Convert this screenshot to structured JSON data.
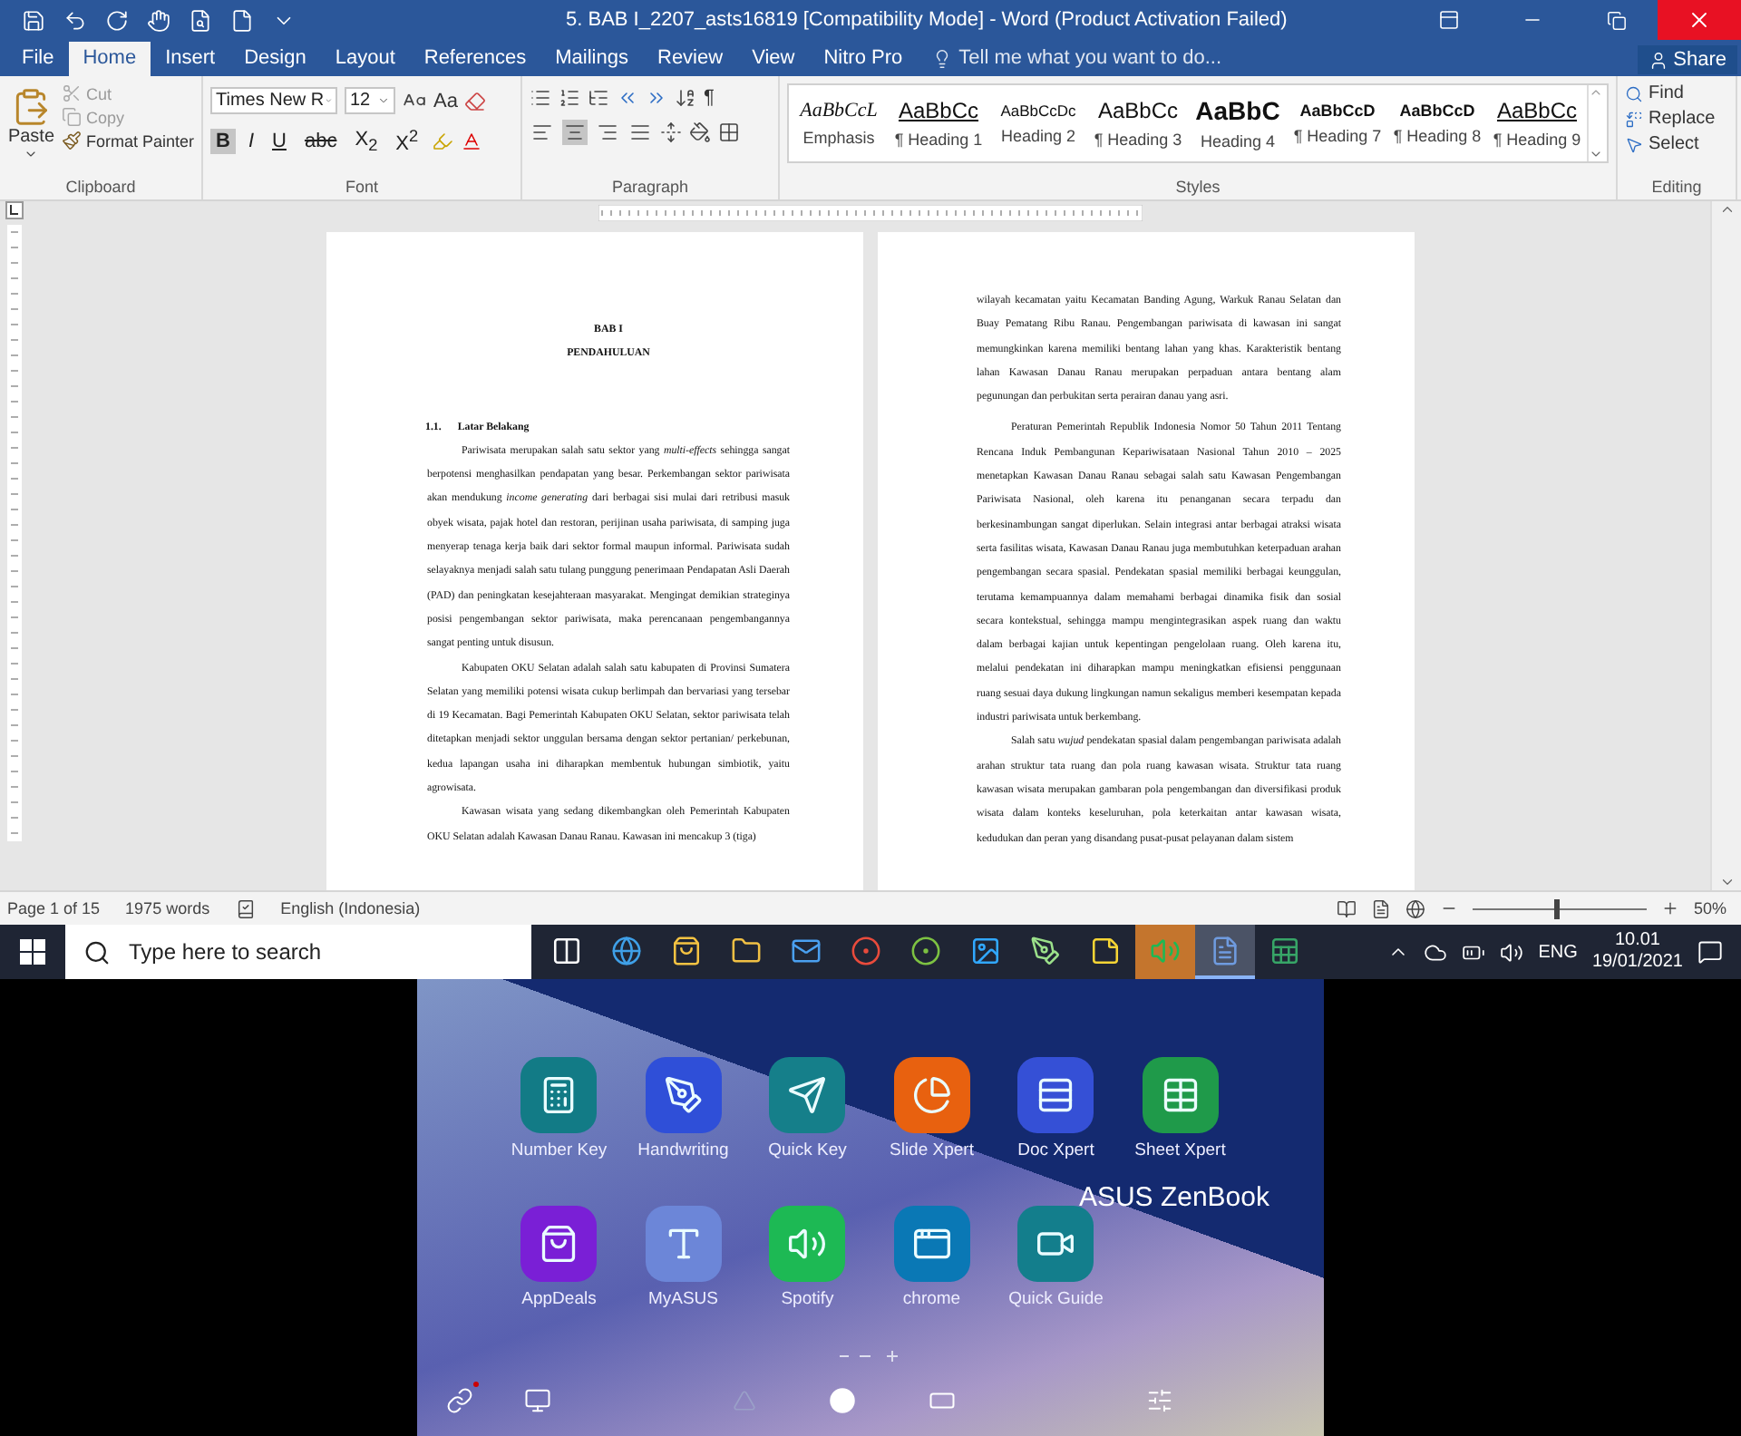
{
  "window": {
    "title": "5. BAB I_2207_asts16819 [Compatibility Mode] - Word (Product Activation Failed)"
  },
  "tabs": [
    {
      "label": "File",
      "selected": false
    },
    {
      "label": "Home",
      "selected": true
    },
    {
      "label": "Insert",
      "selected": false
    },
    {
      "label": "Design",
      "selected": false
    },
    {
      "label": "Layout",
      "selected": false
    },
    {
      "label": "References",
      "selected": false
    },
    {
      "label": "Mailings",
      "selected": false
    },
    {
      "label": "Review",
      "selected": false
    },
    {
      "label": "View",
      "selected": false
    },
    {
      "label": "Nitro Pro",
      "selected": false
    }
  ],
  "tell_me": {
    "placeholder": "Tell me what you want to do..."
  },
  "share": "Share",
  "ribbon": {
    "clipboard": {
      "label": "Clipboard",
      "paste": "Paste",
      "items": [
        {
          "label": "Cut",
          "disabled": true
        },
        {
          "label": "Copy",
          "disabled": true
        },
        {
          "label": "Format Painter",
          "disabled": false
        }
      ]
    },
    "font": {
      "label": "Font",
      "font_name": "Times New R",
      "font_size": "12",
      "change_case": "Aa",
      "format_buttons": [
        {
          "label": "B",
          "selected": true
        },
        {
          "label": "I",
          "selected": false
        },
        {
          "label": "U",
          "selected": false
        },
        {
          "label": "abc",
          "selected": false
        },
        {
          "label": "X$_{2}$",
          "selected": false
        },
        {
          "label": "X$^{2}$",
          "selected": false
        }
      ]
    },
    "paragraph": {
      "label": "Paragraph",
      "pilcrow": "¶",
      "alignment": [
        {
          "selected": false
        },
        {
          "selected": true
        },
        {
          "selected": false
        },
        {
          "selected": false
        }
      ]
    },
    "styles": {
      "label": "Styles",
      "items": [
        {
          "preview": "AaBbCcL",
          "name": "Emphasis"
        },
        {
          "preview": "AaBbCc",
          "name": "¶ Heading 1"
        },
        {
          "preview": "AaBbCcDc",
          "name": "Heading 2"
        },
        {
          "preview": "AaBbCc",
          "name": "¶ Heading 3"
        },
        {
          "preview": "AaBbC",
          "name": "Heading 4"
        },
        {
          "preview": "AaBbCcD",
          "name": "¶ Heading 7"
        },
        {
          "preview": "AaBbCcD",
          "name": "¶ Heading 8"
        },
        {
          "preview": "AaBbCc",
          "name": "¶ Heading 9"
        }
      ]
    },
    "editing": {
      "label": "Editing",
      "items": [
        "Find",
        "Replace",
        "Select"
      ]
    }
  },
  "document": {
    "pages": [
      {
        "blocks": [
          {
            "kind": "title",
            "text": "BAB I"
          },
          {
            "kind": "title",
            "text": "PENDAHULUAN"
          },
          {
            "kind": "section",
            "number": "1.1.",
            "text": "Latar Belakang"
          },
          {
            "kind": "paragraph",
            "text": "Pariwisata merupakan salah satu sektor yang *multi-effects* sehingga sangat berpotensi menghasilkan pendapatan yang besar. Perkembangan sektor pariwisata akan mendukung *income generating* dari berbagai sisi mulai dari retribusi masuk obyek wisata, pajak hotel dan restoran, perijinan usaha pariwisata, di samping juga menyerap tenaga kerja baik dari sektor formal maupun informal. Pariwisata sudah selayaknya menjadi salah satu tulang punggung penerimaan Pendapatan Asli Daerah (PAD) dan peningkatan kesejahteraan masyarakat. Mengingat demikian strateginya posisi pengembangan sektor pariwisata, maka perencanaan pengembangannya sangat penting untuk disusun."
          },
          {
            "kind": "paragraph",
            "text": "Kabupaten OKU Selatan adalah salah satu kabupaten di Provinsi Sumatera Selatan yang memiliki potensi wisata cukup berlimpah dan bervariasi yang tersebar di 19 Kecamatan. Bagi Pemerintah Kabupaten OKU Selatan, sektor pariwisata telah ditetapkan menjadi sektor unggulan bersama dengan sektor pertanian/ perkebunan, kedua lapangan usaha ini diharapkan membentuk hubungan simbiotik, yaitu agrowisata."
          },
          {
            "kind": "paragraph",
            "text": "Kawasan wisata yang sedang dikembangkan oleh Pemerintah Kabupaten OKU Selatan adalah Kawasan Danau Ranau. Kawasan ini mencakup 3 (tiga)"
          }
        ]
      },
      {
        "blocks": [
          {
            "kind": "continuation",
            "text": "wilayah kecamatan yaitu Kecamatan Banding Agung, Warkuk Ranau Selatan dan Buay Pematang Ribu Ranau. Pengembangan pariwisata di kawasan ini sangat memungkinkan karena memiliki bentang lahan yang khas. Karakteristik bentang lahan Kawasan Danau Ranau merupakan perpaduan antara bentang alam pegunungan dan perbukitan serta perairan danau yang asri."
          },
          {
            "kind": "paragraph",
            "text": "Peraturan Pemerintah Republik Indonesia Nomor 50 Tahun 2011 Tentang Rencana Induk Pembangunan Kepariwisataan Nasional Tahun 2010 – 2025 menetapkan Kawasan Danau Ranau sebagai salah satu Kawasan Pengembangan Pariwisata Nasional, oleh karena itu penanganan secara terpadu dan berkesinambungan sangat diperlukan. Selain integrasi antar berbagai atraksi wisata serta fasilitas wisata, Kawasan Danau Ranau juga membutuhkan keterpaduan arahan pengembangan secara spasial. Pendekatan spasial memiliki berbagai keunggulan, terutama kemampuannya dalam memahami berbagai dinamika fisik dan sosial secara kontekstual, sehingga mampu mengintegrasikan aspek ruang dan waktu dalam berbagai kajian untuk kepentingan pengelolaan ruang. Oleh karena itu, melalui pendekatan ini diharapkan mampu meningkatkan efisiensi penggunaan ruang sesuai daya dukung lingkungan namun sekaligus memberi kesempatan kepada industri pariwisata untuk berkembang."
          },
          {
            "kind": "paragraph",
            "text": "Salah satu *wujud* pendekatan spasial dalam pengembangan pariwisata adalah arahan struktur tata ruang dan pola ruang kawasan wisata. Struktur tata ruang kawasan wisata merupakan gambaran pola pengembangan dan diversifikasi produk wisata dalam konteks keseluruhan, pola keterkaitan antar kawasan wisata, kedudukan dan peran yang disandang pusat-pusat pelayanan dalam sistem"
          }
        ]
      }
    ]
  },
  "status_bar": {
    "page": "Page 1 of 15",
    "words": "1975 words",
    "language": "English (Indonesia)",
    "zoom": "50%",
    "zoom_slider": {
      "level": 0.48
    }
  },
  "taskbar": {
    "search_placeholder": "Type here to search",
    "apps": [
      {
        "selected": false,
        "flashing": false
      },
      {
        "selected": false,
        "flashing": false
      },
      {
        "selected": false,
        "flashing": false
      },
      {
        "selected": false,
        "flashing": false
      },
      {
        "selected": false,
        "flashing": false
      },
      {
        "selected": false,
        "flashing": false
      },
      {
        "selected": false,
        "flashing": false
      },
      {
        "selected": false,
        "flashing": false
      },
      {
        "selected": false,
        "flashing": false
      },
      {
        "selected": false,
        "flashing": false
      },
      {
        "selected": false,
        "flashing": true
      },
      {
        "selected": true,
        "flashing": false
      },
      {
        "selected": false,
        "flashing": false
      }
    ],
    "language": "ENG",
    "time": "10.01",
    "date": "19/01/2021"
  },
  "screenpad": {
    "apps": [
      {
        "name": "Number Key",
        "color": "#127b86"
      },
      {
        "name": "Handwriting",
        "color": "#2f4fd8"
      },
      {
        "name": "Quick Key",
        "color": "#157f8a"
      },
      {
        "name": "Slide Xpert",
        "color": "#e8610f"
      },
      {
        "name": "Doc Xpert",
        "color": "#3550d6"
      },
      {
        "name": "Sheet Xpert",
        "color": "#1f9a4a"
      },
      {
        "name": "AppDeals",
        "color": "#7a1fd6"
      },
      {
        "name": "MyASUS",
        "color": "#6c86d8"
      },
      {
        "name": "Spotify",
        "color": "#1db954"
      },
      {
        "name": "chrome",
        "color": "#0a78b5"
      },
      {
        "name": "Quick Guide",
        "color": "#137e8c"
      }
    ],
    "brand": "ASUS ZenBook"
  }
}
